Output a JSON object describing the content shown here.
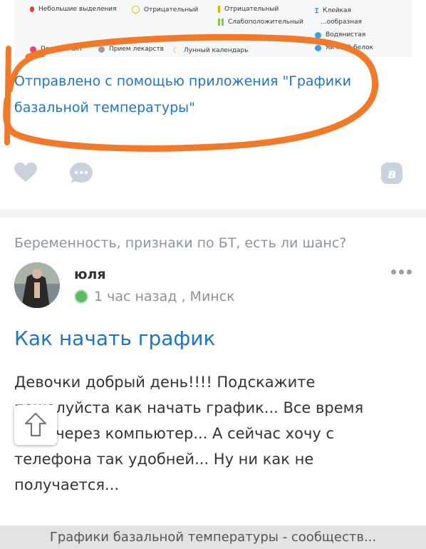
{
  "legend": {
    "items": [
      {
        "label": "Небольшие выделения",
        "color": "#e23b3b"
      },
      {
        "label": "Отрицательный",
        "color": "#f2c200"
      },
      {
        "label": "Отрицательный",
        "color": "#e0b000"
      },
      {
        "label": "Слабоположительный",
        "color": "#8bc34a"
      },
      {
        "label": "Клейкая",
        "color": "#3a7bd5"
      },
      {
        "label": "...ообразная",
        "color": "#3a7bd5"
      },
      {
        "label": "Водянистая",
        "color": "#3aa0e8"
      },
      {
        "label": "Половой акт",
        "color": "#e8457a"
      },
      {
        "label": "Прием лекарств",
        "color": "#9e9e9e"
      },
      {
        "label": "Лунный календарь",
        "color": "#f5a623"
      },
      {
        "label": "Яичный белок",
        "color": "#3aa0e8"
      }
    ]
  },
  "sent_from": {
    "line1": "Отправлено с помощью приложения \"Графики",
    "line2": "базальной температуры\""
  },
  "post": {
    "topic": "Беременность, признаки по БТ, есть ли шанс?",
    "author": "юля",
    "time_location": "1 час назад , Минск",
    "title": "Как начать график",
    "body": [
      "Девочки добрый день!!!! Подскажите",
      "пожалуйста как начать график... Все время",
      "вела через компьютер... А сейчас хочу с",
      "телефона так удобней... Ну ни как не",
      "получается..."
    ]
  },
  "footer": {
    "text": "Графики базальной температуры - сообществ..."
  },
  "colors": {
    "link": "#1e74c6",
    "accent_scribble": "#f07a2a",
    "online": "#5dbb63"
  }
}
